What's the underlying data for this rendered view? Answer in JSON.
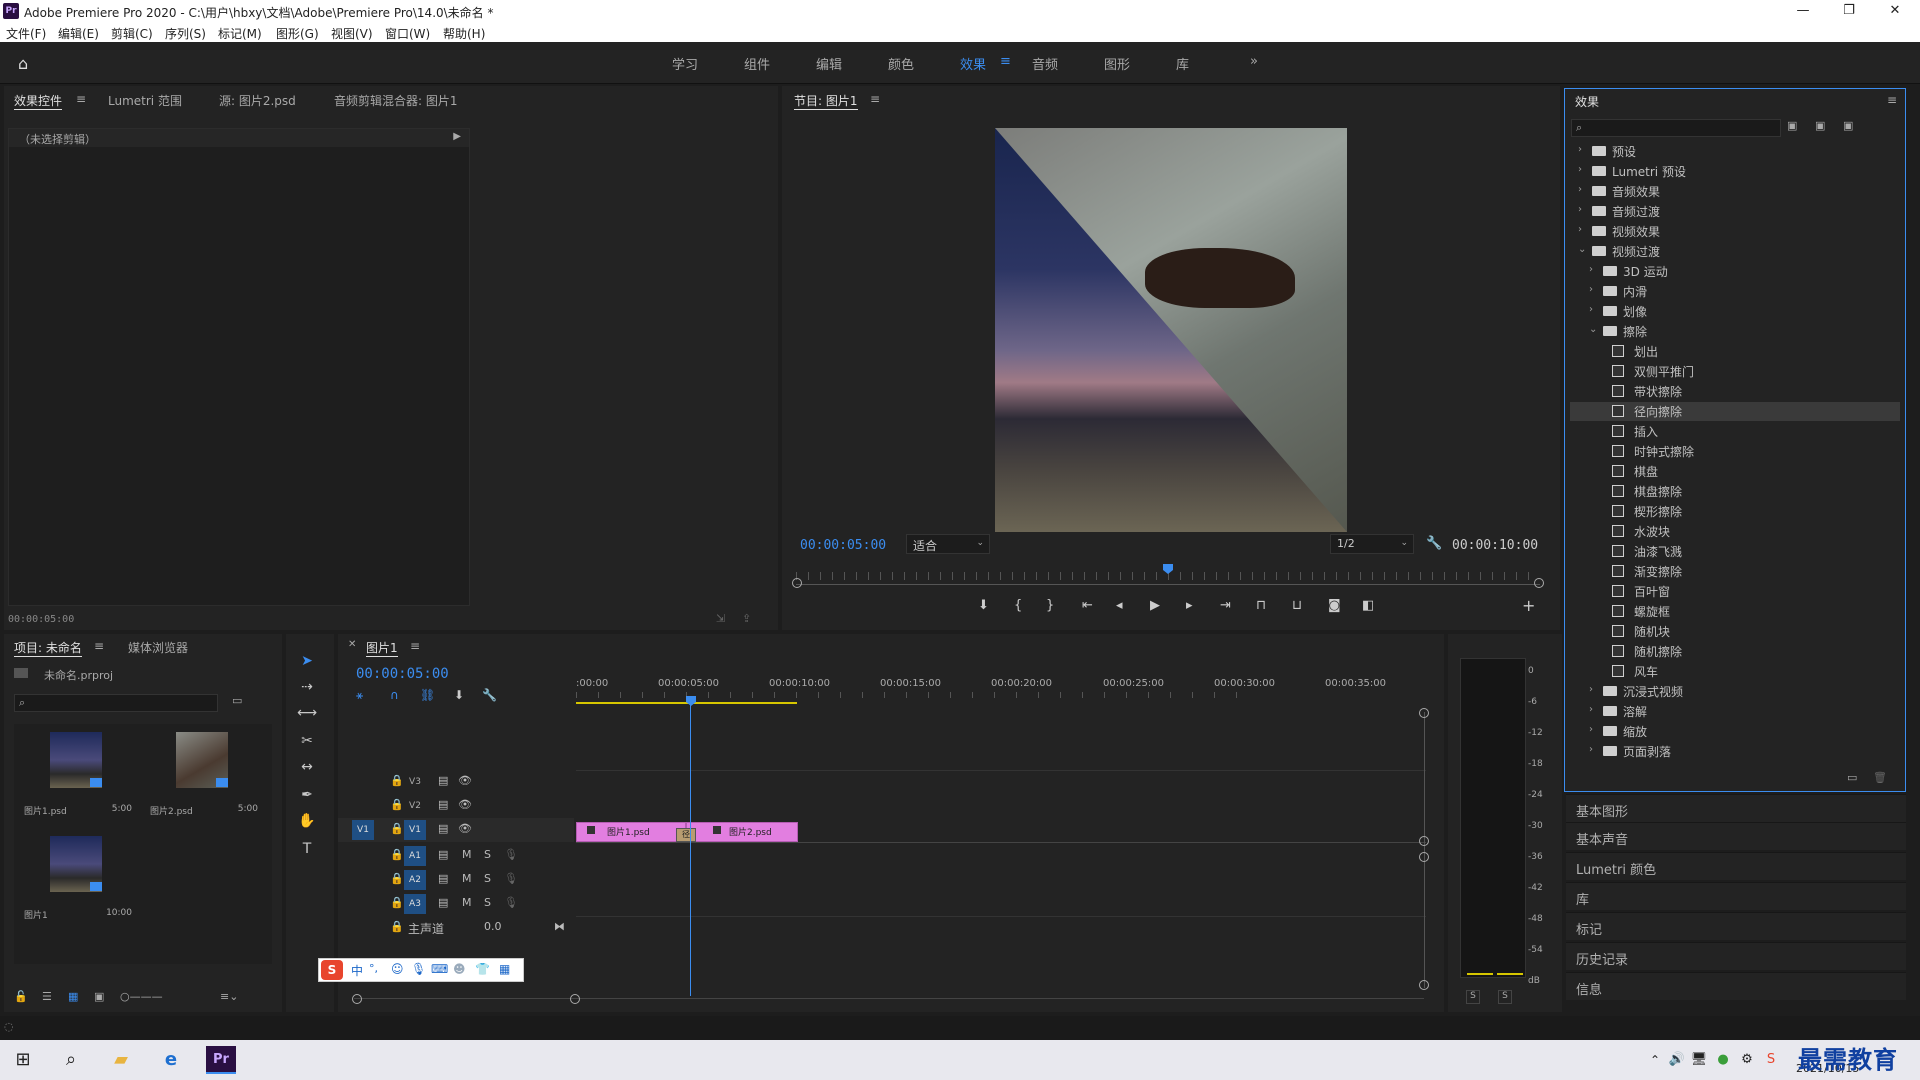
{
  "window": {
    "title": "Adobe Premiere Pro 2020 - C:\\用户\\hbxy\\文档\\Adobe\\Premiere Pro\\14.0\\未命名 *",
    "logo": "Pr"
  },
  "menu": [
    "文件(F)",
    "编辑(E)",
    "剪辑(C)",
    "序列(S)",
    "标记(M)",
    "图形(G)",
    "视图(V)",
    "窗口(W)",
    "帮助(H)"
  ],
  "workspaces": [
    "学习",
    "组件",
    "编辑",
    "颜色",
    "效果",
    "音频",
    "图形",
    "库"
  ],
  "active_workspace": "效果",
  "source_panel": {
    "tabs": [
      "效果控件",
      "Lumetri 范围",
      "源: 图片2.psd",
      "音频剪辑混合器: 图片1"
    ],
    "no_clip": "（未选择剪辑）",
    "timecode": "00:00:05:00"
  },
  "program_monitor": {
    "title": "节目: 图片1",
    "timecode": "00:00:05:00",
    "fit": "适合",
    "resolution": "1/2",
    "duration": "00:00:10:00",
    "playhead": 0.5
  },
  "project_panel": {
    "tabs": [
      "项目: 未命名",
      "媒体浏览器"
    ],
    "project_file": "未命名.prproj",
    "items": [
      {
        "name": "图片1.psd",
        "duration": "5:00"
      },
      {
        "name": "图片2.psd",
        "duration": "5:00"
      },
      {
        "name": "图片1",
        "duration": "10:00"
      }
    ]
  },
  "timeline": {
    "title": "图片1",
    "timecode": "00:00:05:00",
    "ruler": [
      ":00:00",
      "00:00:05:00",
      "00:00:10:00",
      "00:00:15:00",
      "00:00:20:00",
      "00:00:25:00",
      "00:00:30:00",
      "00:00:35:00"
    ],
    "video_tracks": [
      "V3",
      "V2",
      "V1"
    ],
    "audio_tracks": [
      "A1",
      "A2",
      "A3"
    ],
    "source_patch": "V1",
    "master": {
      "label": "主声道",
      "value": "0.0"
    },
    "clips": [
      {
        "name": "图片1.psd"
      },
      {
        "name": "图片2.psd"
      }
    ],
    "transition_label": "径",
    "mute": "M",
    "solo": "S"
  },
  "audio_meter": {
    "scale": [
      "0",
      "-6",
      "-12",
      "-18",
      "-24",
      "-30",
      "-36",
      "-42",
      "-48",
      "-54",
      "dB"
    ],
    "solo": [
      "S",
      "S"
    ]
  },
  "effects_panel": {
    "title": "效果",
    "tree": [
      {
        "label": "预设",
        "level": 0,
        "type": "preset",
        "open": false
      },
      {
        "label": "Lumetri 预设",
        "level": 0,
        "type": "preset",
        "open": false
      },
      {
        "label": "音频效果",
        "level": 0,
        "type": "folder",
        "open": false
      },
      {
        "label": "音频过渡",
        "level": 0,
        "type": "folder",
        "open": false
      },
      {
        "label": "视频效果",
        "level": 0,
        "type": "folder",
        "open": false
      },
      {
        "label": "视频过渡",
        "level": 0,
        "type": "folder",
        "open": true
      },
      {
        "label": "3D 运动",
        "level": 1,
        "type": "folder",
        "open": false
      },
      {
        "label": "内滑",
        "level": 1,
        "type": "folder",
        "open": false
      },
      {
        "label": "划像",
        "level": 1,
        "type": "folder",
        "open": false
      },
      {
        "label": "擦除",
        "level": 1,
        "type": "folder",
        "open": true
      },
      {
        "label": "划出",
        "level": 2,
        "type": "effect"
      },
      {
        "label": "双侧平推门",
        "level": 2,
        "type": "effect"
      },
      {
        "label": "带状擦除",
        "level": 2,
        "type": "effect"
      },
      {
        "label": "径向擦除",
        "level": 2,
        "type": "effect",
        "selected": true
      },
      {
        "label": "插入",
        "level": 2,
        "type": "effect"
      },
      {
        "label": "时钟式擦除",
        "level": 2,
        "type": "effect"
      },
      {
        "label": "棋盘",
        "level": 2,
        "type": "effect"
      },
      {
        "label": "棋盘擦除",
        "level": 2,
        "type": "effect"
      },
      {
        "label": "楔形擦除",
        "level": 2,
        "type": "effect"
      },
      {
        "label": "水波块",
        "level": 2,
        "type": "effect"
      },
      {
        "label": "油漆飞溅",
        "level": 2,
        "type": "effect"
      },
      {
        "label": "渐变擦除",
        "level": 2,
        "type": "effect"
      },
      {
        "label": "百叶窗",
        "level": 2,
        "type": "effect"
      },
      {
        "label": "螺旋框",
        "level": 2,
        "type": "effect"
      },
      {
        "label": "随机块",
        "level": 2,
        "type": "effect"
      },
      {
        "label": "随机擦除",
        "level": 2,
        "type": "effect"
      },
      {
        "label": "风车",
        "level": 2,
        "type": "effect"
      },
      {
        "label": "沉浸式视频",
        "level": 1,
        "type": "folder",
        "open": false
      },
      {
        "label": "溶解",
        "level": 1,
        "type": "folder",
        "open": false
      },
      {
        "label": "缩放",
        "level": 1,
        "type": "folder",
        "open": false
      },
      {
        "label": "页面剥落",
        "level": 1,
        "type": "folder",
        "open": false
      }
    ]
  },
  "side_panels": [
    "基本图形",
    "基本声音",
    "Lumetri 颜色",
    "库",
    "标记",
    "历史记录",
    "信息"
  ],
  "ime": {
    "logo": "S",
    "mode": "中"
  },
  "taskbar": {
    "date": "2021/10/15",
    "watermark": "最需教育"
  },
  "colors": {
    "accent": "#3b8df0",
    "clip": "#e27ee0",
    "premiere": "#2a0f42"
  }
}
